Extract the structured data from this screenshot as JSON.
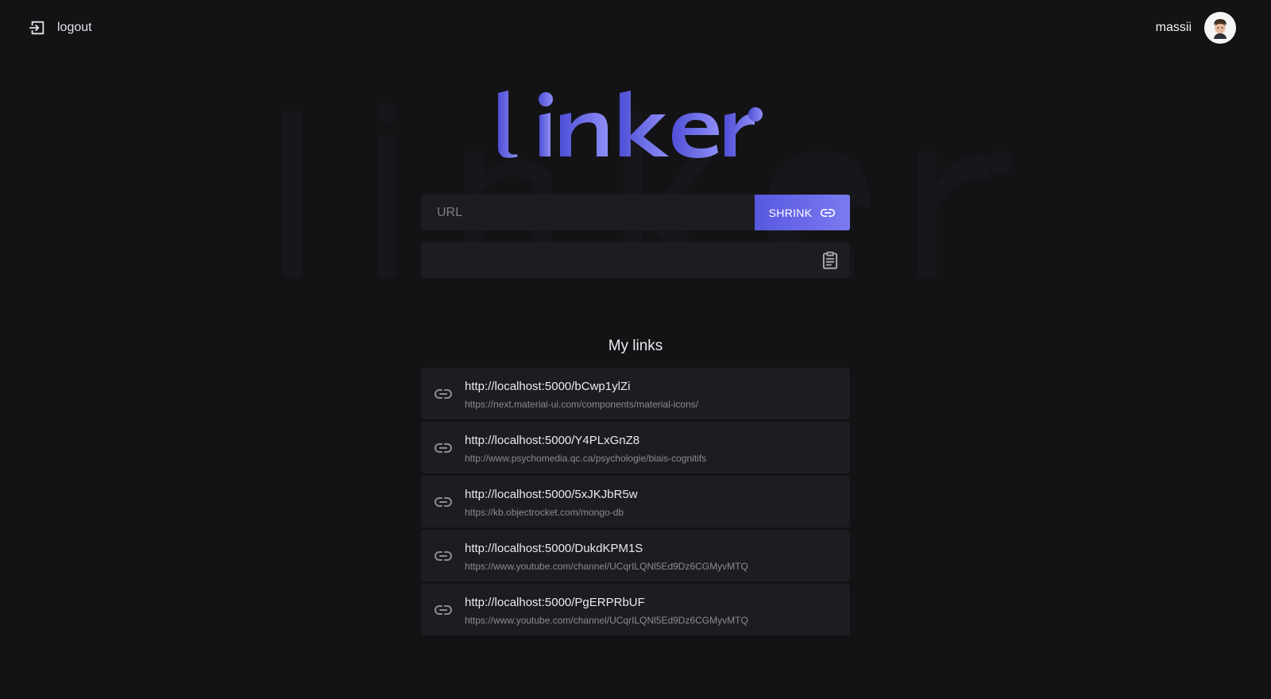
{
  "header": {
    "logout_label": "logout",
    "logout_icon": "logout-icon",
    "username": "massii",
    "avatar_icon": "user-avatar"
  },
  "brand": {
    "logo_text": "linker",
    "gradient": [
      "#4f4fd6",
      "#8e8ef7"
    ]
  },
  "shortener": {
    "url_placeholder": "URL",
    "url_value": "",
    "shrink_label": "SHRINK",
    "shrink_icon": "link-icon",
    "result_value": "",
    "copy_icon": "clipboard-icon"
  },
  "links_section": {
    "title": "My links",
    "items": [
      {
        "short": "http://localhost:5000/bCwp1ylZi",
        "original": "https://next.material-ui.com/components/material-icons/"
      },
      {
        "short": "http://localhost:5000/Y4PLxGnZ8",
        "original": "http://www.psychomedia.qc.ca/psychologie/biais-cognitifs"
      },
      {
        "short": "http://localhost:5000/5xJKJbR5w",
        "original": "https://kb.objectrocket.com/mongo-db"
      },
      {
        "short": "http://localhost:5000/DukdKPM1S",
        "original": "https://www.youtube.com/channel/UCqrILQNl5Ed9Dz6CGMyvMTQ"
      },
      {
        "short": "http://localhost:5000/PgERPRbUF",
        "original": "https://www.youtube.com/channel/UCqrILQNl5Ed9Dz6CGMyvMTQ"
      }
    ]
  },
  "colors": {
    "background": "#131316",
    "surface": "#1d1d21",
    "accent": "#6a6ae8"
  }
}
